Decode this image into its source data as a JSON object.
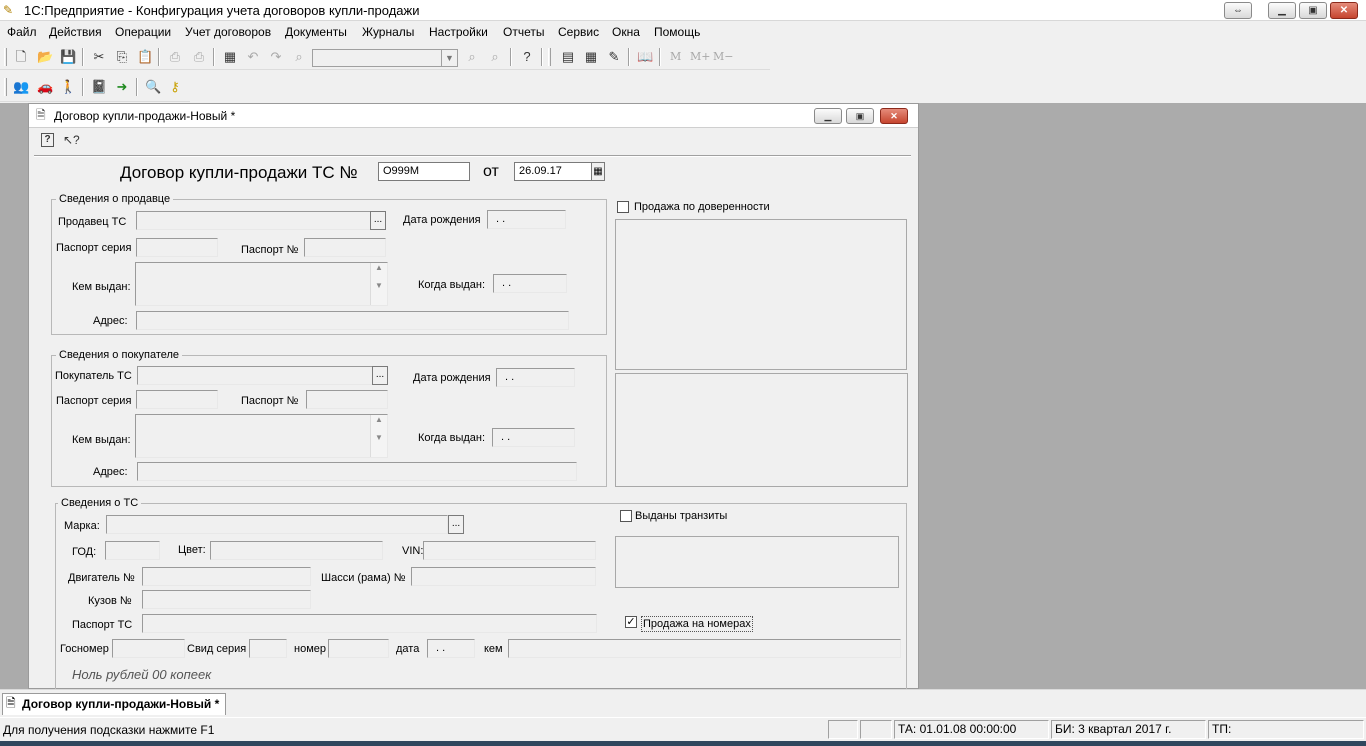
{
  "app": {
    "title": "1С:Предприятие - Конфигурация учета договоров купли-продажи",
    "window_buttons": [
      "⇔",
      "▁",
      "▣",
      "✕"
    ]
  },
  "menu": [
    {
      "label": "Файл"
    },
    {
      "label": "Действия"
    },
    {
      "label": "Операции"
    },
    {
      "label": "Учет договоров"
    },
    {
      "label": "Документы"
    },
    {
      "label": "Журналы"
    },
    {
      "label": "Настройки"
    },
    {
      "label": "Отчеты"
    },
    {
      "label": "Сервис"
    },
    {
      "label": "Окна"
    },
    {
      "label": "Помощь"
    }
  ],
  "toolbar1": {
    "icons": [
      "new-icon",
      "open-icon",
      "save-icon",
      "cut-icon",
      "copy-icon",
      "paste-icon",
      "print-icon",
      "print-preview-icon",
      "calc-icon",
      "undo-icon",
      "redo-icon",
      "find-icon",
      "find-next-icon",
      "find-prev-icon",
      "help-icon",
      "calculator-icon",
      "calendar-icon",
      "context-help-icon",
      "book-icon"
    ],
    "combo_value": "",
    "memory_labels": [
      "M",
      "M+",
      "M−"
    ]
  },
  "toolbar2": {
    "icons": [
      "users-icon",
      "car-icon",
      "person-icon",
      "journal-icon",
      "arrow-right-icon",
      "search-doc-icon",
      "key-icon"
    ]
  },
  "child_window": {
    "title": "Договор купли-продажи-Новый *",
    "buttons": [
      "▁",
      "▣",
      "✕"
    ],
    "toolbar_icons": [
      "help-icon",
      "whats-this-icon"
    ]
  },
  "form": {
    "heading": "Договор купли-продажи ТС №",
    "number_value": "О999М",
    "ot_label": "от",
    "date_value": "26.09.17",
    "seller": {
      "caption": "Сведения о продавце",
      "seller_label": "Продавец ТС",
      "birth_label": "Дата рождения",
      "birth_value": ". .",
      "passport_series_label": "Паспорт серия",
      "passport_no_label": "Паспорт №",
      "issued_by_label": "Кем выдан:",
      "issued_when_label": "Когда выдан:",
      "issued_when_value": ". .",
      "address_label": "Адрес:"
    },
    "buyer": {
      "caption": "Сведения о покупателе",
      "buyer_label": "Покупатель ТС",
      "birth_label": "Дата рождения",
      "birth_value": ". .",
      "passport_series_label": "Паспорт серия",
      "passport_no_label": "Паспорт №",
      "issued_by_label": "Кем выдан:",
      "issued_when_label": "Когда выдан:",
      "issued_when_value": ". .",
      "address_label": "Адрес:"
    },
    "vehicle": {
      "caption": "Сведения о ТС",
      "brand_label": "Марка:",
      "year_label": "ГОД:",
      "color_label": "Цвет:",
      "vin_label": "VIN:",
      "engine_label": "Двигатель №",
      "chassis_label": "Шасси (рама) №",
      "body_label": "Кузов №",
      "passport_label": "Паспорт ТС",
      "plate_label": "Госномер",
      "cert_series_label": "Свид серия",
      "cert_number_label": "номер",
      "cert_date_label": "дата",
      "cert_date_value": ". .",
      "cert_issuer_label": "кем"
    },
    "proxy_checkbox": {
      "label": "Продажа по доверенности",
      "checked": false
    },
    "transit_checkbox": {
      "label": "Выданы транзиты",
      "checked": false
    },
    "plates_checkbox": {
      "label": "Продажа на номерах",
      "checked": true
    },
    "amount_in_words": "Ноль рублей 00 копеек"
  },
  "task_tab": {
    "label": "Договор купли-продажи-Новый *"
  },
  "status": {
    "hint": "Для получения подсказки нажмите F1",
    "ta": "ТА: 01.01.08  00:00:00",
    "bi": "БИ: 3 квартал 2017 г.",
    "tp": "ТП:"
  }
}
